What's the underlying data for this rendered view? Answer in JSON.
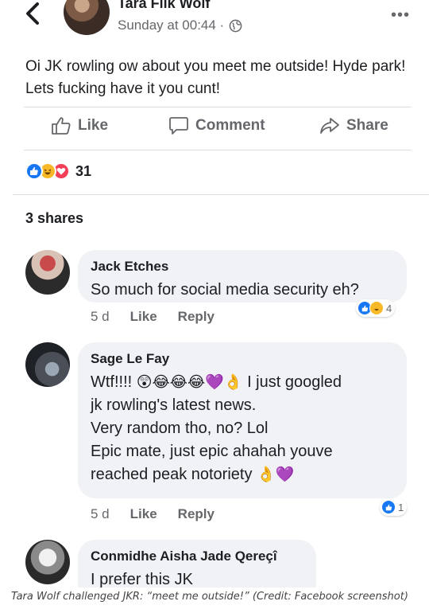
{
  "header": {
    "back_icon": "chevron-left-icon",
    "author_name": "Tara Flik Wolf",
    "timestamp": "Sunday at 00:44 ·",
    "privacy_icon": "globe-icon",
    "more_label": "•••"
  },
  "post": {
    "text": "Oi JK rowling ow about you meet me outside! Hyde park! Lets fucking have it you cunt!"
  },
  "actions": {
    "like_label": "Like",
    "comment_label": "Comment",
    "share_label": "Share"
  },
  "reactions": {
    "types": [
      "like",
      "haha",
      "love"
    ],
    "count": "31"
  },
  "shares_label": "3 shares",
  "comments": [
    {
      "name": "Jack Etches",
      "text": "So much for social media security eh?",
      "age": "5 d",
      "like": "Like",
      "reply": "Reply",
      "reaction_count": "4"
    },
    {
      "name": "Sage Le Fay",
      "line1_prefix": "Wtf!!!! ",
      "line1_emoji": "😲😂😂😂💜👌",
      "line1_suffix": " I just googled",
      "line2": "jk rowling's latest news.",
      "line3": "Very random tho, no? Lol",
      "line4": "Epic mate, just epic ahahah youve",
      "line5_text": "reached peak notoriety ",
      "line5_emoji": "👌💜",
      "age": "5 d",
      "like": "Like",
      "reply": "Reply",
      "reaction_count": "1"
    },
    {
      "name": "Conmidhe Aisha Jade Qereçî",
      "text": "I prefer this JK"
    }
  ],
  "caption": "Tara Wolf challenged JKR: “meet me outside!” (Credit: Facebook screenshot)",
  "colors": {
    "like_blue": "#1877f2",
    "haha_yellow": "#f7b928",
    "love_red": "#f33e58",
    "bubble_grey": "#f0f2f5",
    "meta_grey": "#65676b"
  }
}
